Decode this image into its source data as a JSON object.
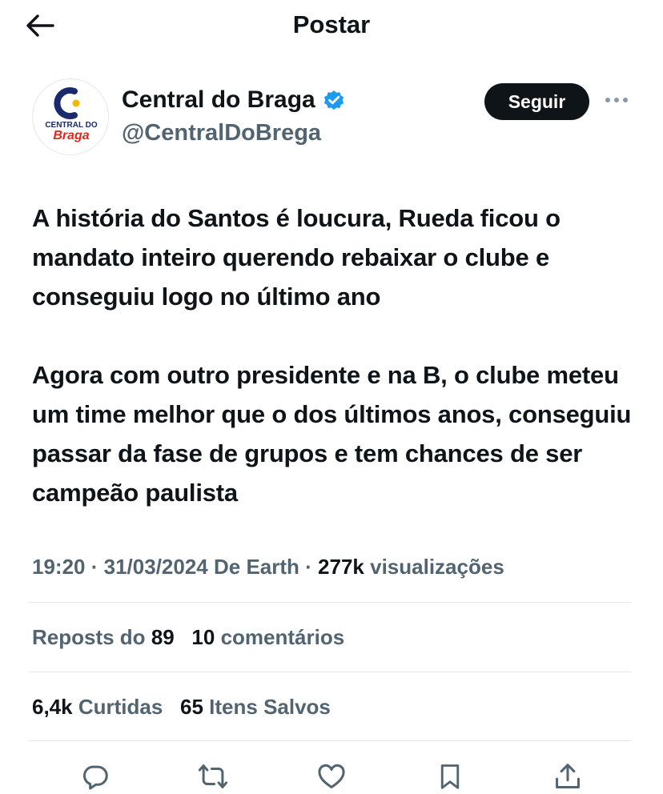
{
  "header": {
    "title": "Postar"
  },
  "author": {
    "name": "Central do Braga",
    "handle": "@CentralDoBrega",
    "avatar_line1": "CENTRAL DO",
    "avatar_line2": "Braga"
  },
  "follow_label": "Seguir",
  "tweet": {
    "paragraphs": [
      "A história do Santos é loucura, Rueda ficou o mandato inteiro querendo rebaixar o clube e conseguiu logo no último ano",
      "Agora com outro presidente e na B, o clube meteu um time melhor que o dos últimos anos, conseguiu passar da fase de grupos e tem chances de ser campeão paulista"
    ]
  },
  "meta": {
    "time": "19:20",
    "date": "31/03/2024",
    "source": "De Earth",
    "views_count": "277k",
    "views_label": "visualizações"
  },
  "stats": {
    "reposts_label": "Reposts do",
    "reposts_count": "89",
    "comments_count": "10",
    "comments_label": "comentários",
    "likes_count": "6,4k",
    "likes_label": "Curtidas",
    "saves_count": "65",
    "saves_label": "Itens Salvos"
  },
  "colors": {
    "text": "#0f1419",
    "secondary": "#536471",
    "verified": "#1d9bf0",
    "brand_red": "#e1261c",
    "brand_yellow": "#f5b800",
    "brand_navy": "#1b2a6b"
  },
  "icons": {
    "back": "arrow-left-icon",
    "verified": "verified-badge-icon",
    "more": "more-dots-icon",
    "reply": "reply-icon",
    "repost": "repost-icon",
    "like": "heart-icon",
    "bookmark": "bookmark-icon",
    "share": "share-icon"
  }
}
